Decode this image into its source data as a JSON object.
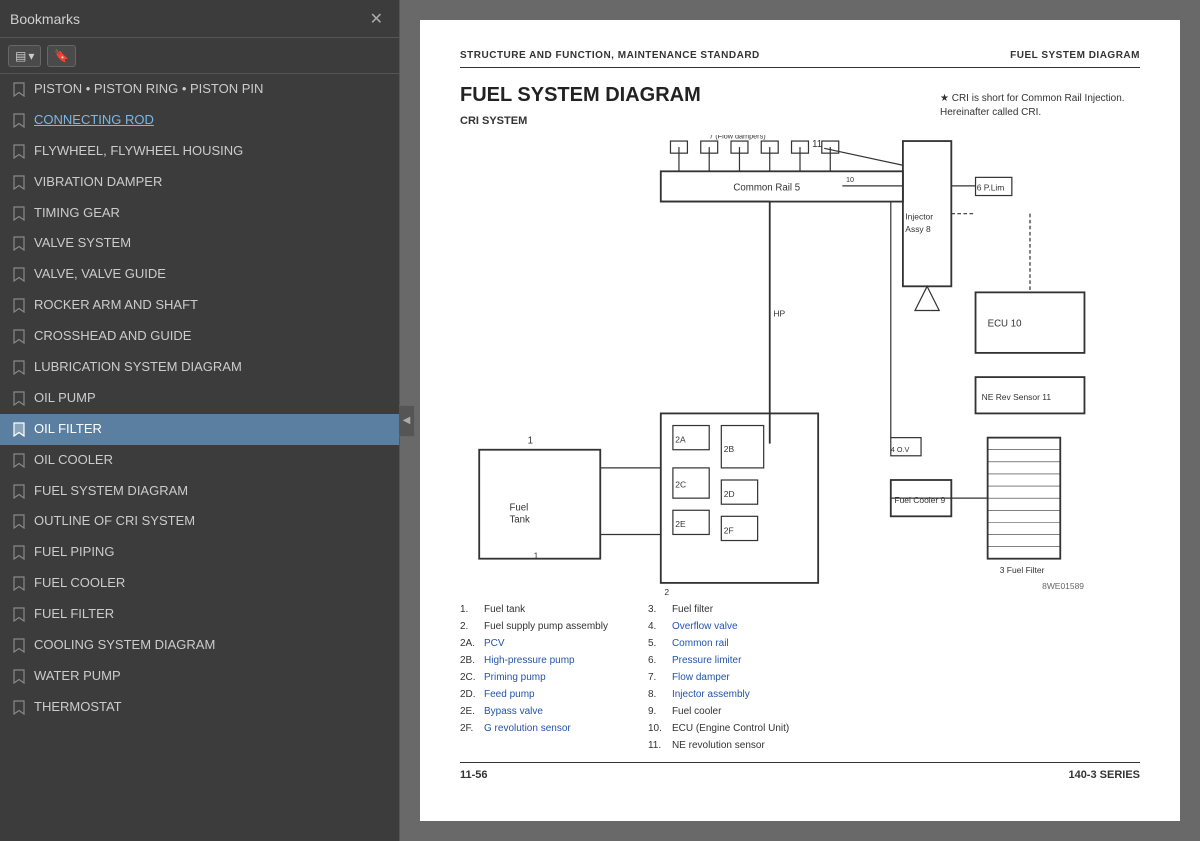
{
  "bookmarks": {
    "title": "Bookmarks",
    "close_label": "✕",
    "toolbar": {
      "view_btn": "▤▾",
      "bookmark_btn": "🔖"
    },
    "items": [
      {
        "id": 0,
        "text": "PISTON • PISTON RING • PISTON PIN",
        "active": false,
        "linked": false
      },
      {
        "id": 1,
        "text": "CONNECTING ROD",
        "active": false,
        "linked": true
      },
      {
        "id": 2,
        "text": "FLYWHEEL, FLYWHEEL HOUSING",
        "active": false,
        "linked": false
      },
      {
        "id": 3,
        "text": "VIBRATION DAMPER",
        "active": false,
        "linked": false
      },
      {
        "id": 4,
        "text": "TIMING GEAR",
        "active": false,
        "linked": false
      },
      {
        "id": 5,
        "text": "VALVE SYSTEM",
        "active": false,
        "linked": false
      },
      {
        "id": 6,
        "text": "VALVE, VALVE GUIDE",
        "active": false,
        "linked": false
      },
      {
        "id": 7,
        "text": "ROCKER ARM AND SHAFT",
        "active": false,
        "linked": false
      },
      {
        "id": 8,
        "text": "CROSSHEAD AND GUIDE",
        "active": false,
        "linked": false
      },
      {
        "id": 9,
        "text": "LUBRICATION SYSTEM DIAGRAM",
        "active": false,
        "linked": false
      },
      {
        "id": 10,
        "text": "OIL PUMP",
        "active": false,
        "linked": false
      },
      {
        "id": 11,
        "text": "OIL FILTER",
        "active": true,
        "linked": false
      },
      {
        "id": 12,
        "text": "OIL COOLER",
        "active": false,
        "linked": false
      },
      {
        "id": 13,
        "text": "FUEL SYSTEM DIAGRAM",
        "active": false,
        "linked": false
      },
      {
        "id": 14,
        "text": "OUTLINE OF CRI SYSTEM",
        "active": false,
        "linked": false
      },
      {
        "id": 15,
        "text": "FUEL PIPING",
        "active": false,
        "linked": false
      },
      {
        "id": 16,
        "text": "FUEL COOLER",
        "active": false,
        "linked": false
      },
      {
        "id": 17,
        "text": "FUEL FILTER",
        "active": false,
        "linked": false
      },
      {
        "id": 18,
        "text": "COOLING SYSTEM DIAGRAM",
        "active": false,
        "linked": false
      },
      {
        "id": 19,
        "text": "WATER PUMP",
        "active": false,
        "linked": false
      },
      {
        "id": 20,
        "text": "THERMOSTAT",
        "active": false,
        "linked": false
      }
    ]
  },
  "document": {
    "header_left": "STRUCTURE AND FUNCTION, MAINTENANCE STANDARD",
    "header_right": "FUEL SYSTEM DIAGRAM",
    "title": "FUEL SYSTEM DIAGRAM",
    "subtitle": "CRI SYSTEM",
    "note": "★  CRI is short for Common Rail Injection. Hereinafter called CRI.",
    "footer_page": "11-56",
    "footer_series": "140-3 SERIES",
    "legend": {
      "col1": [
        {
          "num": "1.",
          "text": "Fuel tank",
          "linked": false
        },
        {
          "num": "2.",
          "text": "Fuel supply pump assembly",
          "linked": false
        },
        {
          "num": "2A.",
          "text": "PCV",
          "linked": true
        },
        {
          "num": "2B.",
          "text": "High-pressure pump",
          "linked": true
        },
        {
          "num": "2C.",
          "text": "Priming pump",
          "linked": true
        },
        {
          "num": "2D.",
          "text": "Feed pump",
          "linked": true
        },
        {
          "num": "2E.",
          "text": "Bypass valve",
          "linked": true
        },
        {
          "num": "2F.",
          "text": "G revolution sensor",
          "linked": true
        }
      ],
      "col2": [
        {
          "num": "3.",
          "text": "Fuel filter",
          "linked": false
        },
        {
          "num": "4.",
          "text": "Overflow valve",
          "linked": true
        },
        {
          "num": "5.",
          "text": "Common rail",
          "linked": true
        },
        {
          "num": "6.",
          "text": "Pressure limiter",
          "linked": true
        },
        {
          "num": "7.",
          "text": "Flow damper",
          "linked": true
        },
        {
          "num": "8.",
          "text": "Injector assembly",
          "linked": true
        },
        {
          "num": "9.",
          "text": "Fuel cooler",
          "linked": false
        },
        {
          "num": "10.",
          "text": "ECU (Engine Control Unit)",
          "linked": false
        },
        {
          "num": "11.",
          "text": "NE revolution sensor",
          "linked": false
        }
      ]
    }
  },
  "icons": {
    "bookmark_empty": "bookmark-empty",
    "bookmark_filled": "bookmark-filled",
    "chevron_left": "◀"
  }
}
